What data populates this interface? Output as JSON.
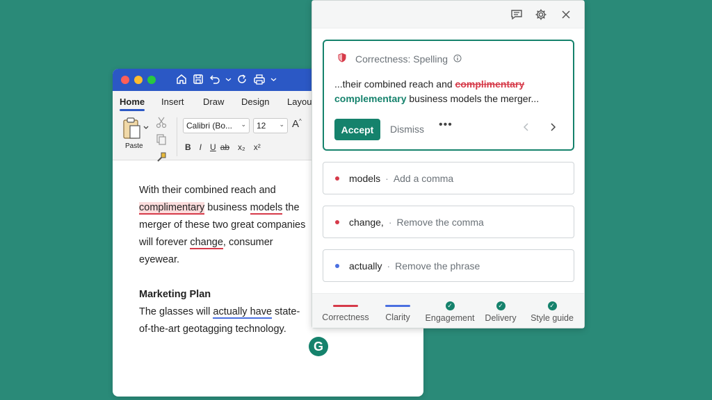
{
  "word": {
    "tabs": [
      "Home",
      "Insert",
      "Draw",
      "Design",
      "Layou"
    ],
    "paste_label": "Paste",
    "font_name": "Calibri (Bo...",
    "font_size": "12",
    "format_buttons": [
      "B",
      "I",
      "U",
      "ab",
      "x₂",
      "x²"
    ],
    "doc": {
      "p1_a": "With their combined reach and",
      "p1_spell": "complimentary",
      "p1_b": " business ",
      "p1_models": "models",
      "p1_c": " the merger of these two great companies will forever ",
      "p1_change": "change",
      "p1_d": ", consumer eyewear.",
      "heading": "Marketing Plan",
      "p2_a": "The glasses will ",
      "p2_actually": "actually have",
      "p2_b": " state-of-the-art geotagging technology."
    },
    "logo_letter": "G"
  },
  "panel": {
    "main_card": {
      "category": "Correctness: Spelling",
      "text_before": "...their combined reach and ",
      "strike": "complimentary",
      "replacement": "complementary",
      "text_after": " business models the merger...",
      "accept": "Accept",
      "dismiss": "Dismiss",
      "more": "•••"
    },
    "cards": [
      {
        "word": "models",
        "hint": "Add a comma",
        "color": "#d63a49"
      },
      {
        "word": "change,",
        "hint": "Remove the comma",
        "color": "#d63a49"
      },
      {
        "word": "actually",
        "hint": "Remove the phrase",
        "color": "#4a6fe0"
      }
    ],
    "separator": "·",
    "categories": [
      {
        "label": "Correctness",
        "indicator": "bar",
        "color": "#d63a49"
      },
      {
        "label": "Clarity",
        "indicator": "bar",
        "color": "#4a6fe0"
      },
      {
        "label": "Engagement",
        "indicator": "check"
      },
      {
        "label": "Delivery",
        "indicator": "check"
      },
      {
        "label": "Style guide",
        "indicator": "check"
      }
    ]
  },
  "colors": {
    "background": "#2a8a78",
    "brand": "#15826c",
    "error": "#d63a49",
    "clarity": "#4a6fe0",
    "word_blue": "#2b58c5"
  }
}
